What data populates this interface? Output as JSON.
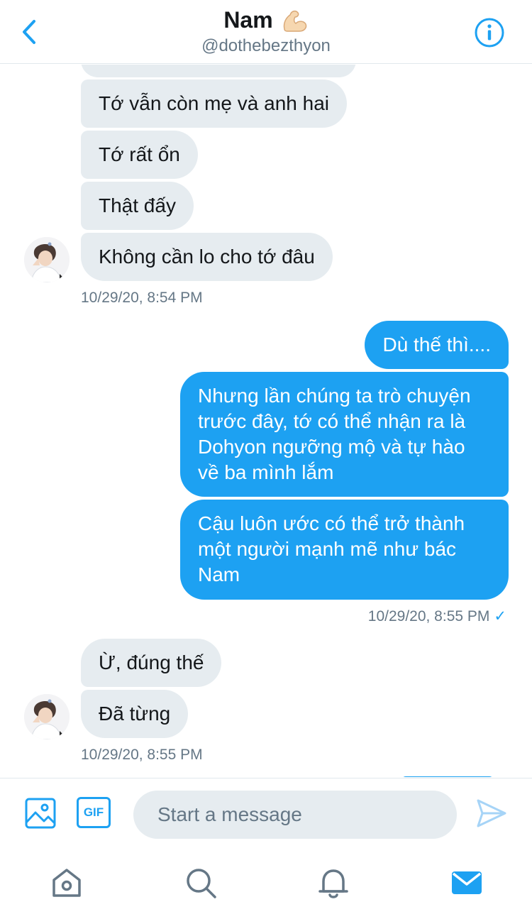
{
  "header": {
    "name": "Nam",
    "emoji": "💪🏻",
    "handle": "@dothebezthyon"
  },
  "messages": [
    {
      "dir": "in",
      "text": ""
    },
    {
      "dir": "in",
      "text": "Tớ vẫn còn mẹ và anh hai"
    },
    {
      "dir": "in",
      "text": "Tớ rất ổn"
    },
    {
      "dir": "in",
      "text": "Thật đấy"
    },
    {
      "dir": "in",
      "text": "Không cần lo cho tớ đâu"
    },
    {
      "dir": "out",
      "text": "Dù thế thì...."
    },
    {
      "dir": "out",
      "text": "Nhưng lần chúng ta trò chuyện trước đây, tớ có thể nhận ra là Dohyon ngưỡng mộ và tự hào về ba mình lắm"
    },
    {
      "dir": "out",
      "text": "Cậu luôn ước có thể trở thành một người mạnh mẽ như bác Nam"
    },
    {
      "dir": "in",
      "text": "Ừ, đúng thế"
    },
    {
      "dir": "in",
      "text": "Đã từng"
    }
  ],
  "timestamps": {
    "t1": "10/29/20, 8:54 PM",
    "t2": "10/29/20, 8:55 PM",
    "t2_check": "✓",
    "t3": "10/29/20, 8:55 PM"
  },
  "composer": {
    "gif_label": "GIF",
    "placeholder": "Start a message"
  },
  "colors": {
    "accent": "#1da1f2",
    "incoming_bubble": "#e6ecf0",
    "muted_text": "#657786"
  },
  "icons": {
    "back": "chevron-left-icon",
    "info": "info-icon",
    "media": "image-icon",
    "send": "send-icon",
    "home": "home-icon",
    "search": "search-icon",
    "notifications": "bell-icon",
    "messages": "mail-icon"
  }
}
